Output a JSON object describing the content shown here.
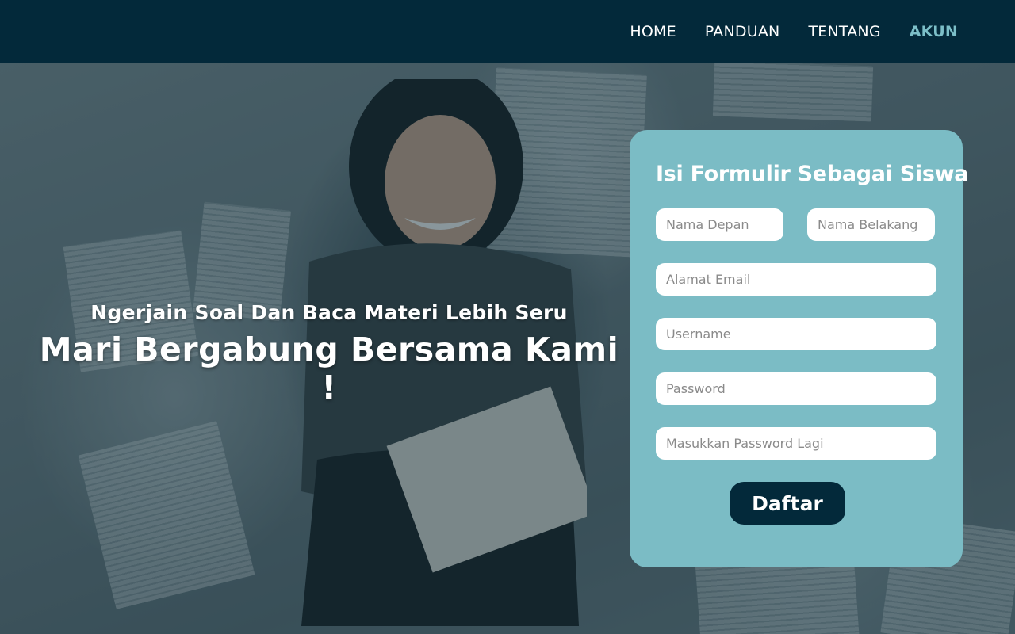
{
  "nav": {
    "items": [
      {
        "label": "HOME",
        "active": false
      },
      {
        "label": "PANDUAN",
        "active": false
      },
      {
        "label": "TENTANG",
        "active": false
      },
      {
        "label": "AKUN",
        "active": true
      }
    ]
  },
  "hero": {
    "subtitle": "Ngerjain Soal Dan Baca Materi Lebih Seru",
    "title": "Mari Bergabung Bersama Kami !"
  },
  "form": {
    "title": "Isi Formulir Sebagai Siswa",
    "fields": {
      "first_name": {
        "placeholder": "Nama Depan",
        "value": ""
      },
      "last_name": {
        "placeholder": "Nama Belakang",
        "value": ""
      },
      "email": {
        "placeholder": "Alamat Email",
        "value": ""
      },
      "username": {
        "placeholder": "Username",
        "value": ""
      },
      "password": {
        "placeholder": "Password",
        "value": ""
      },
      "password_confirm": {
        "placeholder": "Masukkan Password Lagi",
        "value": ""
      }
    },
    "submit_label": "Daftar"
  },
  "colors": {
    "navbar": "#03293a",
    "nav_active": "#7cbfc8",
    "card": "#7bbcc5",
    "button": "#03293a"
  }
}
